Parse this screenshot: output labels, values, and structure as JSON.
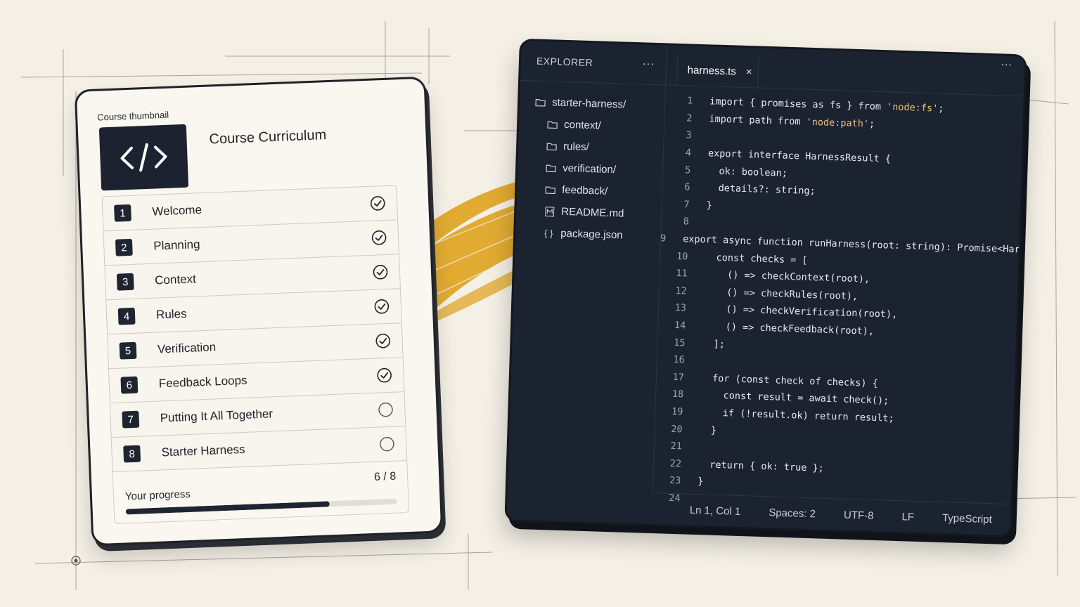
{
  "curriculum": {
    "thumbnail_label": "Course thumbnail",
    "thumbnail_icon": "code-brackets-icon",
    "title": "Course Curriculum",
    "lessons": [
      {
        "number": "1",
        "title": "Welcome",
        "completed": true
      },
      {
        "number": "2",
        "title": "Planning",
        "completed": true
      },
      {
        "number": "3",
        "title": "Context",
        "completed": true
      },
      {
        "number": "4",
        "title": "Rules",
        "completed": true
      },
      {
        "number": "5",
        "title": "Verification",
        "completed": true
      },
      {
        "number": "6",
        "title": "Feedback Loops",
        "completed": true
      },
      {
        "number": "7",
        "title": "Putting It All Together",
        "completed": false
      },
      {
        "number": "8",
        "title": "Starter Harness",
        "completed": false
      }
    ],
    "progress": {
      "label": "Your progress",
      "count": "6 / 8",
      "fraction": 0.75
    }
  },
  "editor": {
    "explorer": {
      "title": "EXPLORER",
      "more": "···",
      "items": [
        {
          "name": "starter-harness/",
          "icon": "folder-icon",
          "level": 0
        },
        {
          "name": "context/",
          "icon": "folder-icon",
          "level": 1
        },
        {
          "name": "rules/",
          "icon": "folder-icon",
          "level": 1
        },
        {
          "name": "verification/",
          "icon": "folder-icon",
          "level": 1
        },
        {
          "name": "feedback/",
          "icon": "folder-icon",
          "level": 1
        },
        {
          "name": "README.md",
          "icon": "markdown-icon",
          "level": 1
        },
        {
          "name": "package.json",
          "icon": "json-braces-icon",
          "level": 1
        }
      ]
    },
    "tab": {
      "label": "harness.ts",
      "close": "×"
    },
    "window_more": "···",
    "code_lines": [
      "import { promises as fs } from 'node:fs';",
      "import path from 'node:path';",
      "",
      "export interface HarnessResult {",
      "  ok: boolean;",
      "  details?: string;",
      "}",
      "",
      "export async function runHarness(root: string): Promise<HarnessResult> {",
      "  const checks = [",
      "    () => checkContext(root),",
      "    () => checkRules(root),",
      "    () => checkVerification(root),",
      "    () => checkFeedback(root),",
      "  ];",
      "",
      "  for (const check of checks) {",
      "    const result = await check();",
      "    if (!result.ok) return result;",
      "  }",
      "",
      "  return { ok: true };",
      "}",
      ""
    ],
    "status": {
      "cursor": "Ln 1, Col 1",
      "spaces": "Spaces: 2",
      "encoding": "UTF-8",
      "eol": "LF",
      "language": "TypeScript"
    }
  },
  "colors": {
    "background": "#f4f0e6",
    "editor_bg": "#1c2330",
    "accent_brush": "#e0a829",
    "string": "#e8c27a"
  }
}
